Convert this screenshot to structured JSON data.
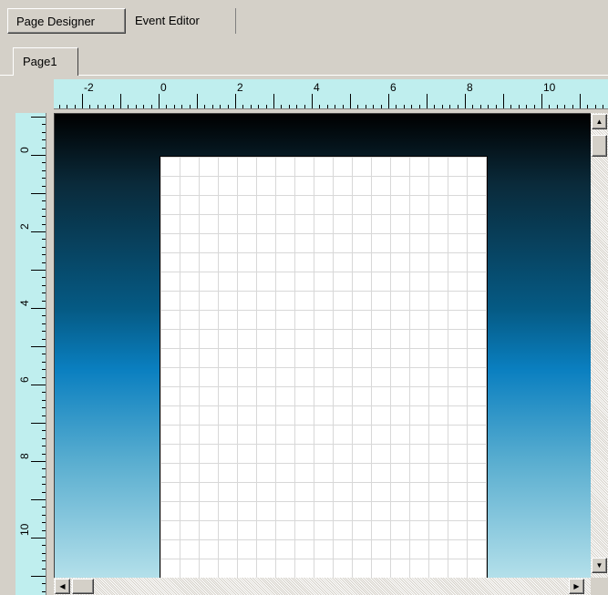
{
  "tabs": {
    "page_designer": "Page Designer",
    "event_editor": "Event Editor"
  },
  "page_tabs": {
    "page1": "Page1"
  },
  "ruler": {
    "horizontal_labels": [
      "-2",
      "0",
      "2",
      "4",
      "6",
      "8",
      "10"
    ],
    "vertical_labels": [
      "0",
      "2",
      "4",
      "6",
      "8",
      "10"
    ]
  },
  "colors": {
    "ruler_bg": "#bfeeee",
    "canvas_gradient_top": "#000000",
    "canvas_gradient_mid": "#0a7fc0",
    "canvas_gradient_bottom": "#b4e0ea",
    "page_bg": "#ffffff",
    "grid_line": "#d8d8d8"
  },
  "icons": {
    "scroll_up": "arrow-up-icon",
    "scroll_down": "arrow-down-icon",
    "scroll_left": "arrow-left-icon",
    "scroll_right": "arrow-right-icon"
  }
}
